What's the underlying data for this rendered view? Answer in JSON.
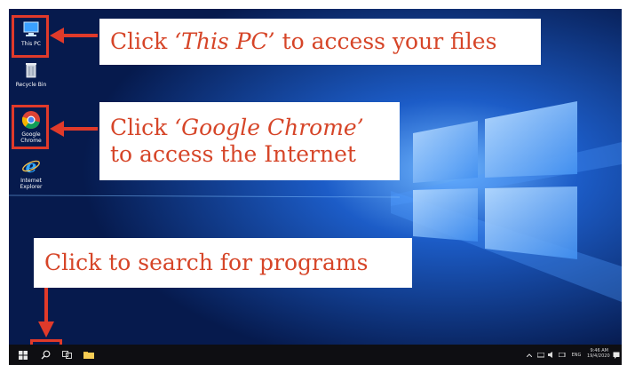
{
  "desktop": {
    "icons": [
      {
        "label": "This PC",
        "icon": "this-pc-icon"
      },
      {
        "label": "Recycle Bin",
        "icon": "recycle-bin-icon"
      },
      {
        "label": "Google Chrome",
        "icon": "chrome-icon"
      },
      {
        "label": "Internet Explorer",
        "icon": "internet-explorer-icon"
      }
    ]
  },
  "callouts": {
    "this_pc": {
      "prefix": "Click ",
      "emphasis": "‘This PC’",
      "suffix": " to access your files"
    },
    "chrome": {
      "prefix": "Click ",
      "emphasis": "‘Google Chrome’",
      "line2": "to access the Internet"
    },
    "search": {
      "text": "Click to search for programs"
    }
  },
  "taskbar": {
    "buttons": [
      "start-icon",
      "search-icon",
      "task-view-icon",
      "file-explorer-icon"
    ],
    "language": "ENG",
    "time": "9:46 AM",
    "date": "19/4/2020"
  },
  "colors": {
    "accent": "#e03a2a",
    "callout_text": "#d64528",
    "desktop": "#0a1f5c",
    "taskbar": "#0e0e12"
  }
}
